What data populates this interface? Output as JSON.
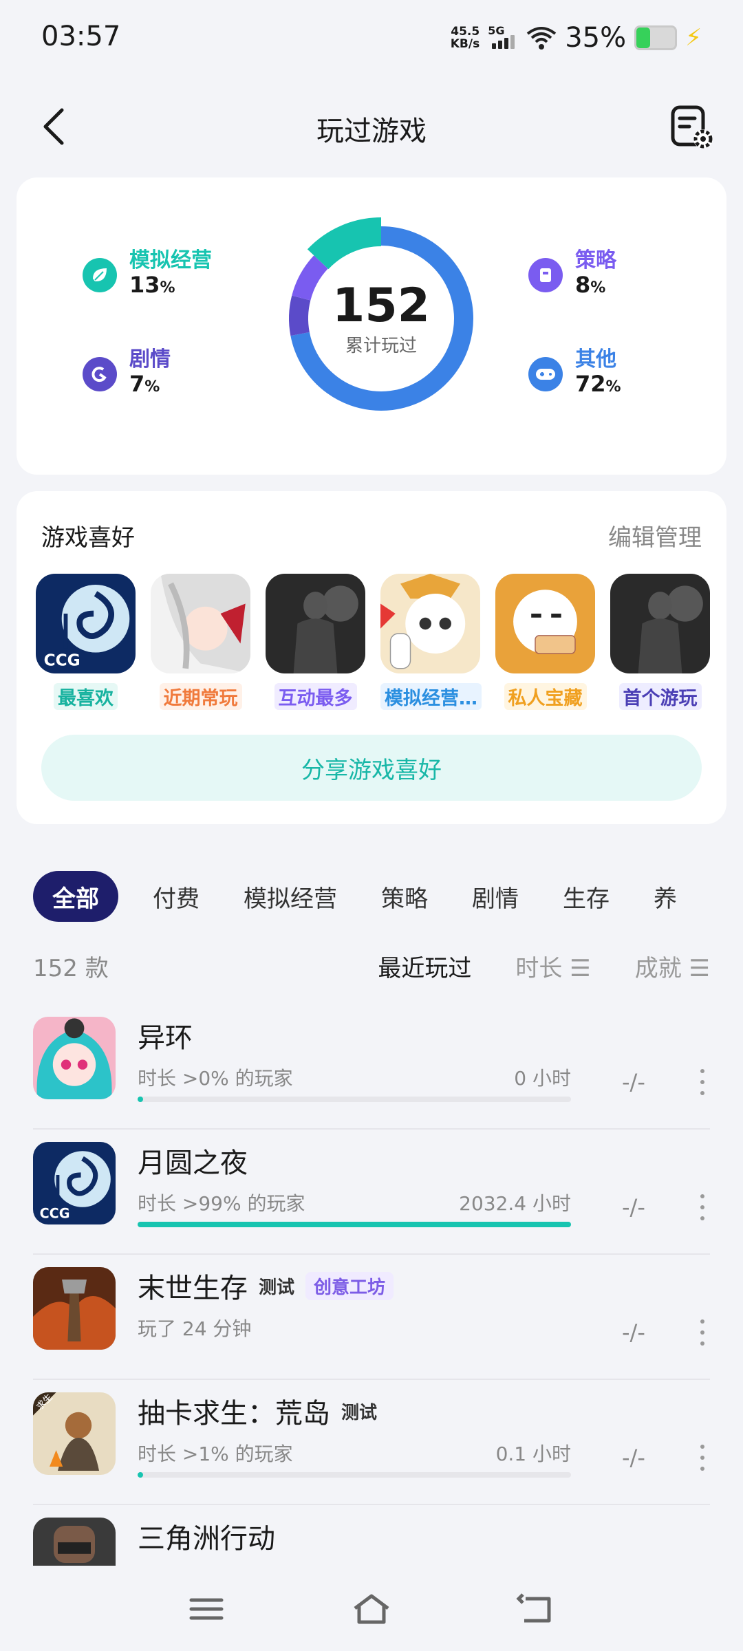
{
  "status": {
    "time": "03:57",
    "speed_top": "45.5",
    "speed_unit": "KB/s",
    "network": "5G",
    "battery": "35%"
  },
  "header": {
    "title": "玩过游戏"
  },
  "stats": {
    "total": "152",
    "total_label": "累计玩过",
    "categories": [
      {
        "name": "模拟经营",
        "pct": "13",
        "color": "#17c4b0"
      },
      {
        "name": "剧情",
        "pct": "7",
        "color": "#5b4bc9"
      },
      {
        "name": "策略",
        "pct": "8",
        "color": "#7a5cf0"
      },
      {
        "name": "其他",
        "pct": "72",
        "color": "#3b82e6"
      }
    ],
    "pct_unit": "%"
  },
  "prefs": {
    "title": "游戏喜好",
    "edit": "编辑管理",
    "share": "分享游戏喜好",
    "games": [
      {
        "tag": "最喜欢",
        "color": "#17b29f",
        "bg": "#e6f8f5",
        "art": "ccg"
      },
      {
        "tag": "近期常玩",
        "color": "#f07a3c",
        "bg": "#fff1e8",
        "art": "anime"
      },
      {
        "tag": "互动最多",
        "color": "#7b5cf0",
        "bg": "#f0ecff",
        "art": "dark"
      },
      {
        "tag": "模拟经营…",
        "color": "#2b8fe0",
        "bg": "#e8f3ff",
        "art": "cute"
      },
      {
        "tag": "私人宝藏",
        "color": "#f0a020",
        "bg": "#fff5e1",
        "art": "face"
      },
      {
        "tag": "首个游玩",
        "color": "#4b3fb5",
        "bg": "#eeedff",
        "art": "dark"
      }
    ]
  },
  "tabs": [
    "全部",
    "付费",
    "模拟经营",
    "策略",
    "剧情",
    "生存",
    "养"
  ],
  "list": {
    "count": "152 款",
    "sorts": [
      {
        "label": "最近玩过",
        "active": true
      },
      {
        "label": "时长 ☰",
        "active": false
      },
      {
        "label": "成就 ☰",
        "active": false
      }
    ],
    "items": [
      {
        "name": "异环",
        "badges": [],
        "sub": "时长 >0% 的玩家",
        "hours": "0 小时",
        "progress": 0.01,
        "ach": "-/-",
        "art": "anime2"
      },
      {
        "name": "月圆之夜",
        "badges": [],
        "sub": "时长 >99% 的玩家",
        "hours": "2032.4 小时",
        "progress": 1.0,
        "ach": "-/-",
        "art": "ccg"
      },
      {
        "name": "末世生存",
        "badges": [
          "测试"
        ],
        "badge2": "创意工坊",
        "sub": "玩了 24 分钟",
        "hours": "",
        "progress": null,
        "ach": "-/-",
        "art": "fire"
      },
      {
        "name": "抽卡求生：荒岛",
        "badges": [
          "测试"
        ],
        "sub": "时长 >1% 的玩家",
        "hours": "0.1 小时",
        "progress": 0.01,
        "ach": "-/-",
        "art": "island"
      },
      {
        "name": "三角洲行动",
        "badges": [],
        "sub": "",
        "hours": "",
        "progress": null,
        "ach": "",
        "art": "soldier"
      }
    ]
  }
}
